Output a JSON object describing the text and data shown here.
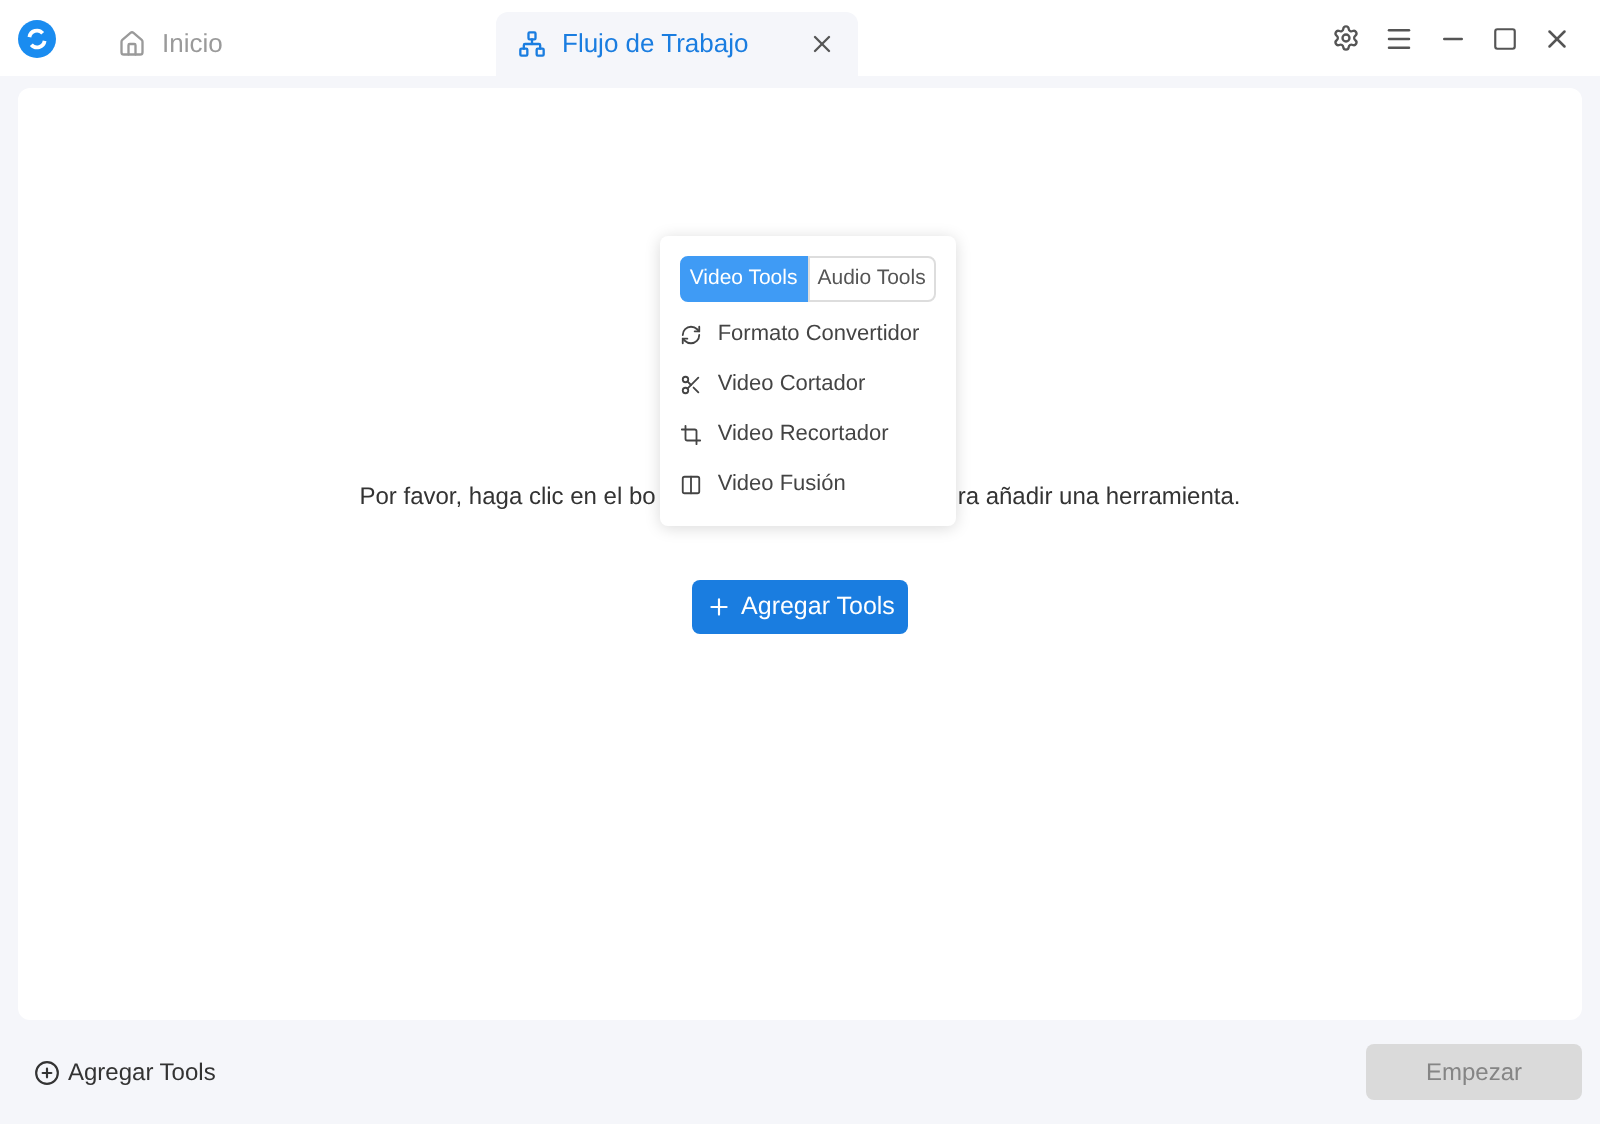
{
  "tabs": [
    {
      "label": "Inicio",
      "selected": false
    },
    {
      "label": "Flujo de Trabajo",
      "selected": true
    }
  ],
  "instruction": {
    "left": "Por favor, haga clic en el bo",
    "right": "ra añadir una herramienta."
  },
  "popover": {
    "tabs": [
      {
        "label": "Video Tools",
        "selected": true
      },
      {
        "label": "Audio Tools",
        "selected": false
      }
    ],
    "items": [
      {
        "label": "Formato Convertidor"
      },
      {
        "label": "Video Cortador"
      },
      {
        "label": "Video Recortador"
      },
      {
        "label": "Video Fusión"
      }
    ]
  },
  "add_button": "Agregar Tools",
  "footer": {
    "add_link": "Agregar Tools",
    "start_button": {
      "label": "Empezar",
      "disabled": true
    }
  }
}
